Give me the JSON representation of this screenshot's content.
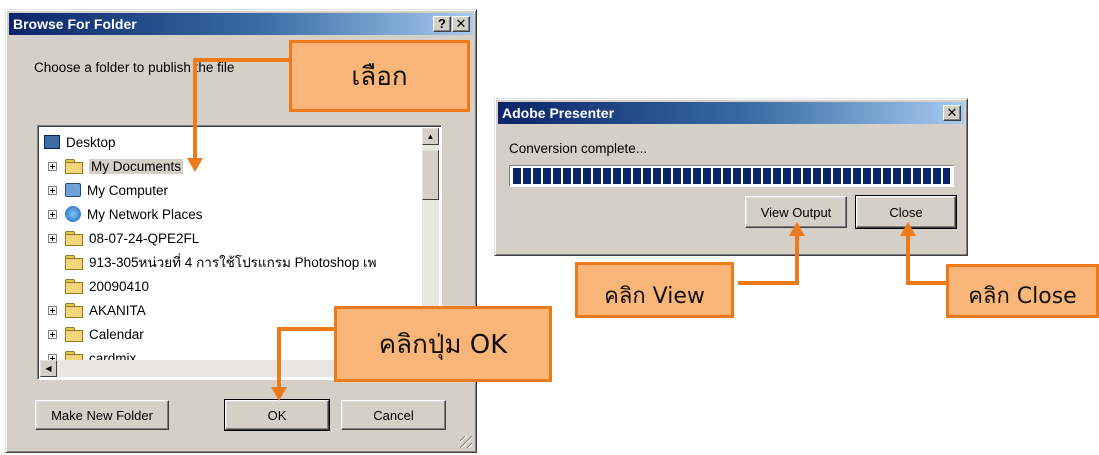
{
  "browse": {
    "title": "Browse For Folder",
    "help_label": "?",
    "close_label": "✕",
    "prompt": "Choose a folder to publish the file",
    "tree": [
      {
        "label": "Desktop",
        "icon": "desktop-icon",
        "expander": false
      },
      {
        "label": "My Documents",
        "icon": "my-documents-icon",
        "expander": true,
        "selected": true
      },
      {
        "label": "My Computer",
        "icon": "my-computer-icon",
        "expander": true
      },
      {
        "label": "My Network Places",
        "icon": "network-places-icon",
        "expander": true
      },
      {
        "label": "08-07-24-QPE2FL",
        "icon": "folder-icon",
        "expander": true
      },
      {
        "label": "913-305หน่วยที่ 4 การใช้โปรแกรม Photoshop เพ",
        "icon": "folder-icon",
        "expander": false
      },
      {
        "label": "20090410",
        "icon": "folder-icon",
        "expander": false
      },
      {
        "label": "AKANITA",
        "icon": "folder-icon",
        "expander": true
      },
      {
        "label": "Calendar",
        "icon": "folder-icon",
        "expander": true
      },
      {
        "label": "cardmix",
        "icon": "folder-icon",
        "expander": true
      }
    ],
    "make_new_folder_label": "Make New Folder",
    "ok_label": "OK",
    "cancel_label": "Cancel"
  },
  "presenter": {
    "title": "Adobe Presenter",
    "close_label": "✕",
    "status": "Conversion complete...",
    "progress": 1.0,
    "view_output_label": "View Output",
    "close_button_label": "Close"
  },
  "callouts": {
    "select": "เลือก",
    "click_ok": "คลิกปุ่ม OK",
    "click_view": "คลิก View",
    "click_close": "คลิก Close"
  },
  "colors": {
    "accent_orange": "#ef7a1a",
    "callout_fill": "#fab578",
    "title_blue": "#0a246a",
    "window_gray": "#d4d0c8"
  }
}
